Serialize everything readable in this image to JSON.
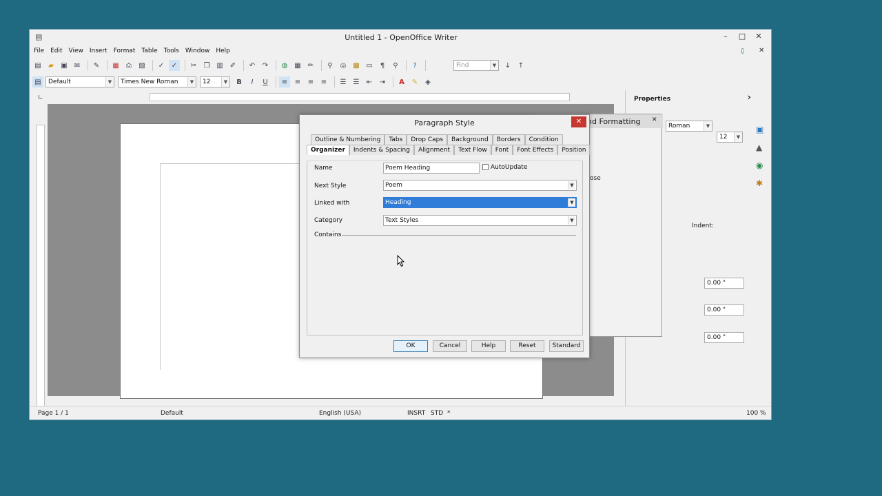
{
  "window": {
    "title": "Untitled 1 - OpenOffice Writer"
  },
  "menu": [
    "File",
    "Edit",
    "View",
    "Insert",
    "Format",
    "Table",
    "Tools",
    "Window",
    "Help"
  ],
  "toolbar": {
    "find_placeholder": "Find"
  },
  "formatting": {
    "style": "Default",
    "font": "Times New Roman",
    "size": "12"
  },
  "sidebar": {
    "title": "Properties",
    "font": "Roman",
    "size": "12",
    "indent_label": "Indent:",
    "spin1": "0.00 \"",
    "spin2": "0.00 \"",
    "spin3": "0.00 \""
  },
  "styles_panel": {
    "title": "nd Formatting",
    "item": "ose"
  },
  "dialog": {
    "title": "Paragraph Style",
    "tabs_back": [
      "Outline & Numbering",
      "Tabs",
      "Drop Caps",
      "Background",
      "Borders",
      "Condition"
    ],
    "tabs_front": [
      "Organizer",
      "Indents & Spacing",
      "Alignment",
      "Text Flow",
      "Font",
      "Font Effects",
      "Position"
    ],
    "name_label": "Name",
    "name_value": "Poem Heading",
    "autoupdate_label": "AutoUpdate",
    "next_style_label": "Next Style",
    "next_style_value": "Poem",
    "linked_label": "Linked with",
    "linked_value": "Heading",
    "category_label": "Category",
    "category_value": "Text Styles",
    "contains_label": "Contains",
    "buttons": {
      "ok": "OK",
      "cancel": "Cancel",
      "help": "Help",
      "reset": "Reset",
      "standard": "Standard"
    }
  },
  "status": {
    "page": "Page 1 / 1",
    "style": "Default",
    "language": "English (USA)",
    "insert": "INSRT",
    "std": "STD",
    "mod": "*",
    "zoom": "100 %"
  }
}
